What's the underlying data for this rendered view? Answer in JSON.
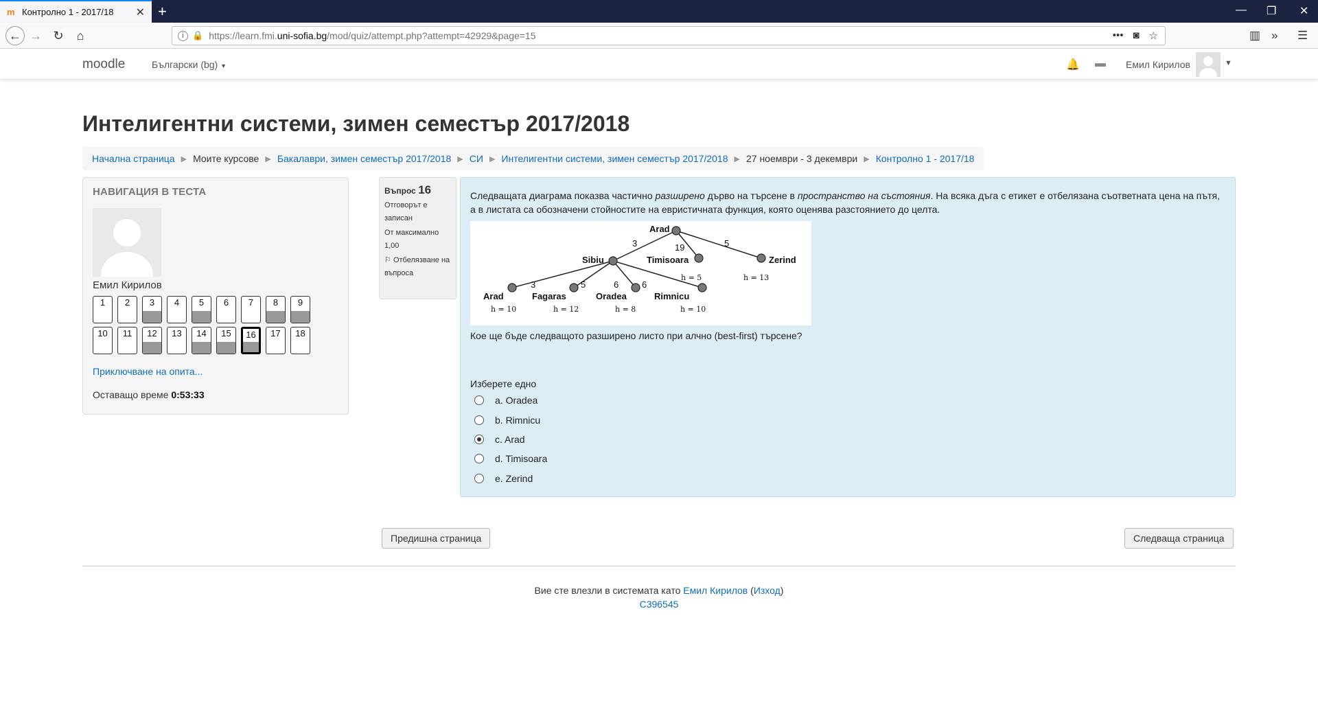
{
  "browser": {
    "tab_title": "Контролно 1 - 2017/18",
    "url_prefix": "https://learn.fmi.",
    "url_domain": "uni-sofia.bg",
    "url_path": "/mod/quiz/attempt.php?attempt=42929&page=15"
  },
  "header": {
    "brand": "moodle",
    "language": "Български (bg)",
    "user_name": "Емил Кирилов"
  },
  "page_title": "Интелигентни системи, зимен семестър 2017/2018",
  "breadcrumb": [
    {
      "label": "Начална страница",
      "link": true
    },
    {
      "label": "Моите курсове",
      "link": false
    },
    {
      "label": "Бакалаври, зимен семестър 2017/2018",
      "link": true
    },
    {
      "label": "СИ",
      "link": true
    },
    {
      "label": "Интелигентни системи, зимен семестър 2017/2018",
      "link": true
    },
    {
      "label": "27 ноември - 3 декември",
      "link": false
    },
    {
      "label": "Контролно 1 - 2017/18",
      "link": true
    }
  ],
  "quiz_nav": {
    "heading": "Навигация в теста",
    "student_name": "Емил Кирилов",
    "questions": [
      {
        "n": "1",
        "answered": false
      },
      {
        "n": "2",
        "answered": false
      },
      {
        "n": "3",
        "answered": true
      },
      {
        "n": "4",
        "answered": false
      },
      {
        "n": "5",
        "answered": true
      },
      {
        "n": "6",
        "answered": false
      },
      {
        "n": "7",
        "answered": false
      },
      {
        "n": "8",
        "answered": true
      },
      {
        "n": "9",
        "answered": true
      },
      {
        "n": "10",
        "answered": false
      },
      {
        "n": "11",
        "answered": false
      },
      {
        "n": "12",
        "answered": true
      },
      {
        "n": "13",
        "answered": false
      },
      {
        "n": "14",
        "answered": true
      },
      {
        "n": "15",
        "answered": true
      },
      {
        "n": "16",
        "answered": true,
        "current": true
      },
      {
        "n": "17",
        "answered": false
      },
      {
        "n": "18",
        "answered": false
      }
    ],
    "finish_link": "Приключване на опита...",
    "time_label": "Оставащо време",
    "time_value": "0:53:33"
  },
  "question_info": {
    "label": "Въпрос",
    "number": "16",
    "state": "Отговорът е записан",
    "mark": "От максимално 1,00",
    "flag": "Отбелязване на въпроса"
  },
  "question": {
    "text_1": "Следващата диаграма показва частично ",
    "text_italic_1": "разширено",
    "text_2": " дърво на търсене в ",
    "text_italic_2": "пространство на състояния",
    "text_3": ". На всяка дъга с етикет е отбелязана съответната цена на пътя, а в листата са обозначени стойностите на евристичната функция, която оценява разстоянието до целта.",
    "question_line": "Кое ще бъде следващото разширено листо при алчно (best-first) търсене?",
    "prompt": "Изберете едно",
    "options": [
      {
        "label": "a. Oradea",
        "selected": false
      },
      {
        "label": "b. Rimnicu",
        "selected": false
      },
      {
        "label": "c. Arad",
        "selected": true
      },
      {
        "label": "d. Timisoara",
        "selected": false
      },
      {
        "label": "e. Zerind",
        "selected": false
      }
    ],
    "tree": {
      "nodes": {
        "arad_root": "Arad",
        "sibiu": "Sibiu",
        "timisoara": "Timisoara",
        "zerind": "Zerind",
        "arad_leaf": "Arad",
        "fagaras": "Fagaras",
        "oradea": "Oradea",
        "rimnicu": "Rimnicu"
      },
      "edges": {
        "arad_sibiu": "3",
        "arad_timisoara": "19",
        "arad_zerind": "5",
        "sibiu_arad": "3",
        "sibiu_fagaras": "5",
        "sibiu_oradea": "6",
        "sibiu_rimnicu": "6"
      },
      "h": {
        "timisoara": "h = 5",
        "zerind": "h = 13",
        "arad_leaf": "h = 10",
        "fagaras": "h = 12",
        "oradea": "h = 8",
        "rimnicu": "h = 10"
      }
    }
  },
  "buttons": {
    "prev": "Предишна страница",
    "next": "Следваща страница"
  },
  "footer": {
    "logged_in_as": "Вие сте влезли в системата като",
    "user": "Емил Кирилов",
    "logout": "Изход",
    "code": "C396545"
  }
}
